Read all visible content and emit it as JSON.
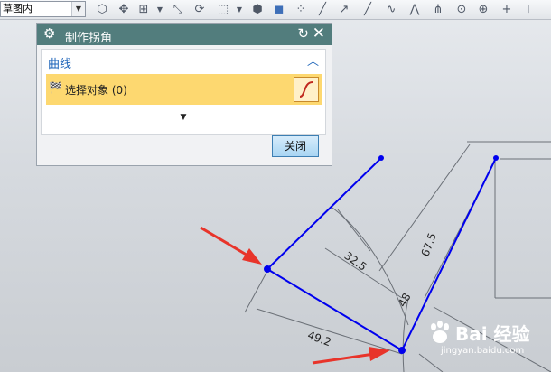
{
  "toolbar": {
    "filter_value": "草图内",
    "icons": [
      "snap-view-icon",
      "point-icon",
      "select-icon",
      "dropdown-icon",
      "move-icon",
      "rotate-icon",
      "box-select-icon",
      "dropdown-icon",
      "shaded-view-icon",
      "cube-icon",
      "grid-points-icon",
      "line-icon",
      "diagonal-line-icon",
      "curve-icon",
      "node-icon",
      "arrow-up-icon",
      "circle-icon",
      "target-icon",
      "plus-icon",
      "cross-icon"
    ]
  },
  "dialog": {
    "title": "制作拐角",
    "section_title": "曲线",
    "select_label": "选择对象 (0)",
    "close_label": "关闭"
  },
  "dimensions": {
    "d1": "32.5",
    "d2": "67.5",
    "d3": "49.2",
    "d4": "48"
  },
  "watermark": {
    "brand": "Bai 经验",
    "url": "jingyan.baidu.com"
  },
  "colors": {
    "title_bar": "#527d7d",
    "sketch_line": "#0000ee",
    "annotation_arrow": "#e8342a",
    "selection_row": "#fdd870"
  }
}
